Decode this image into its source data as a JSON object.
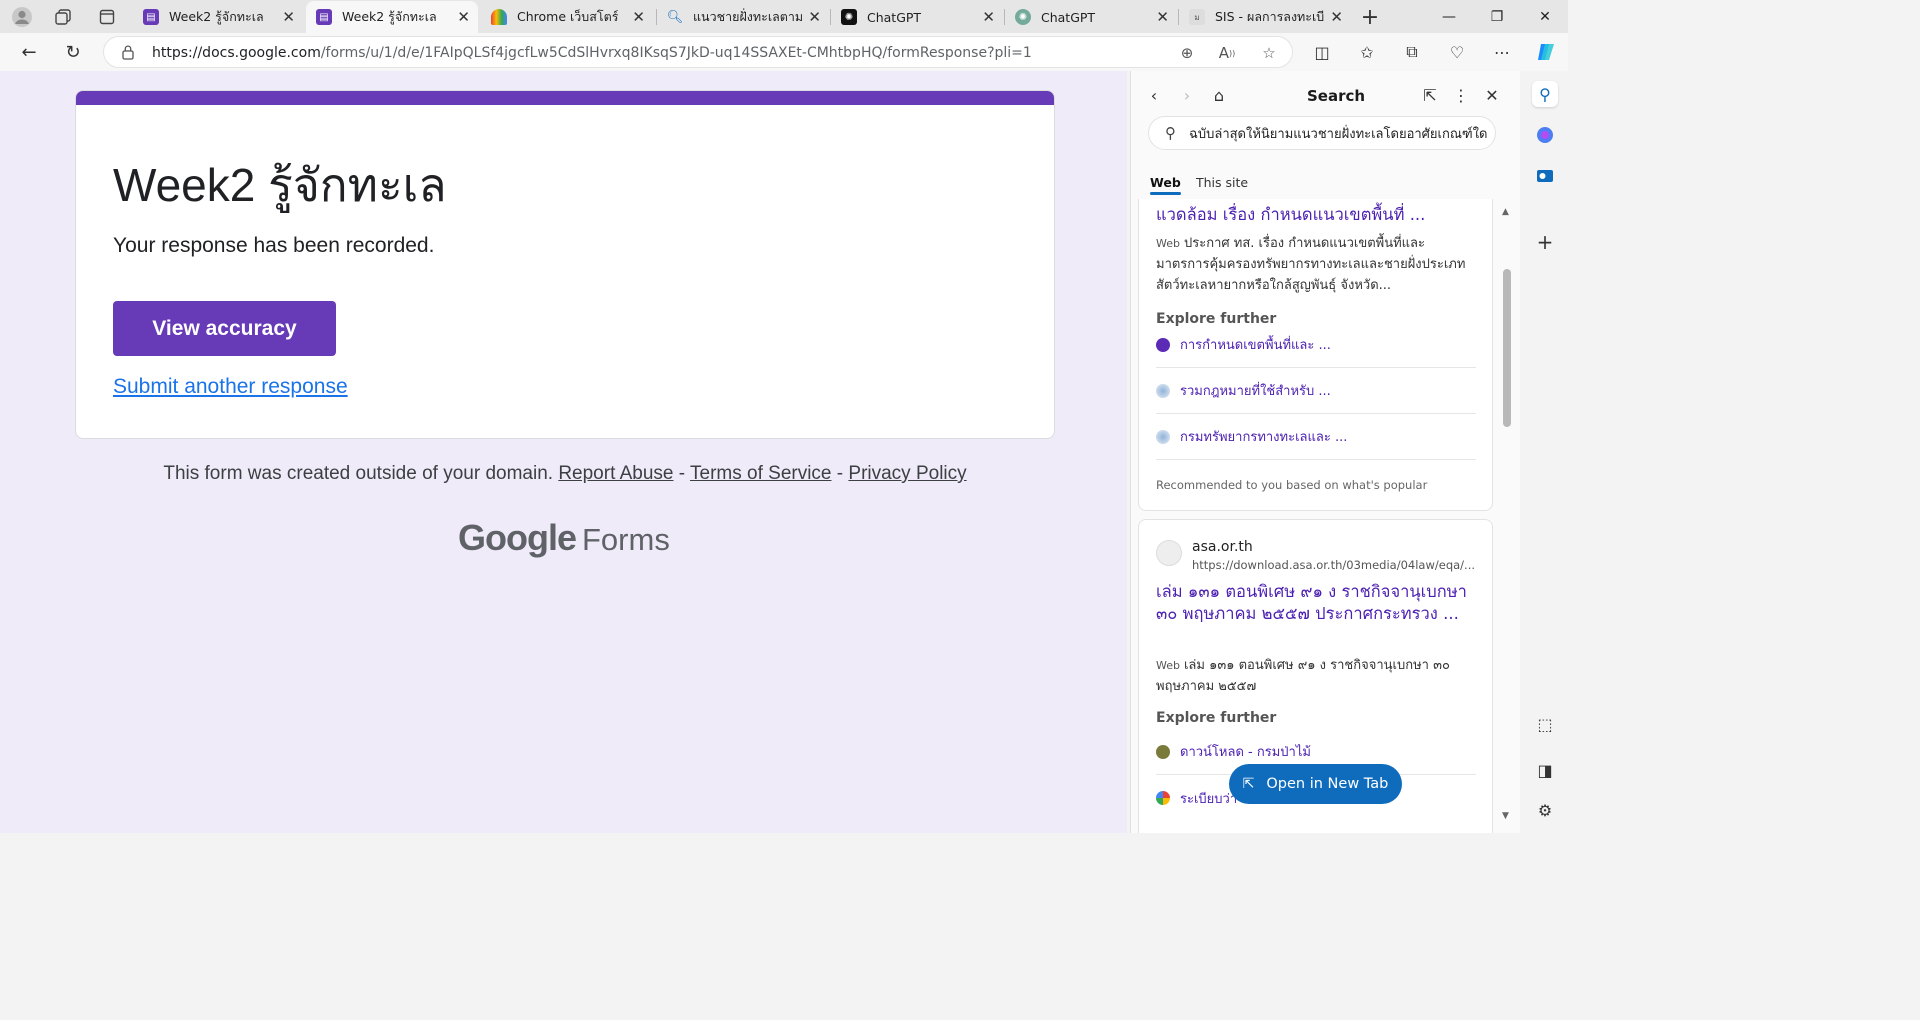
{
  "tabs": [
    {
      "label": "Week2 รู้จักทะเล",
      "active": false,
      "favicon": "google-forms-icon"
    },
    {
      "label": "Week2 รู้จักทะเล",
      "active": true,
      "favicon": "google-forms-icon"
    },
    {
      "label": "Chrome เว็บสโตร์",
      "active": false,
      "favicon": "chrome-webstore-icon"
    },
    {
      "label": "แนวชายฝั่งทะเลตามประ",
      "active": false,
      "favicon": "search-icon"
    },
    {
      "label": "ChatGPT",
      "active": false,
      "favicon": "openai-icon"
    },
    {
      "label": "ChatGPT",
      "active": false,
      "favicon": "openai-icon"
    },
    {
      "label": "SIS - ผลการลงทะเบียน",
      "active": false,
      "favicon": "sis-icon"
    }
  ],
  "address": {
    "host": "https://docs.google.com",
    "path": "/forms/u/1/d/e/1FAIpQLSf4jgcfLw5CdSlHvrxq8IKsqS7JkD-uq14SSAXEt-CMhtbpHQ/formResponse?pli=1"
  },
  "form": {
    "title": "Week2 รู้จักทะเล",
    "message": "Your response has been recorded.",
    "view_accuracy": "View accuracy",
    "submit_another": "Submit another response",
    "footer_text": "This form was created outside of your domain.",
    "report_abuse": "Report Abuse",
    "terms": "Terms of Service",
    "privacy": "Privacy Policy",
    "sep": "-",
    "logo_google": "Google",
    "logo_forms": "Forms",
    "accent_color": "#673ab7"
  },
  "panel": {
    "title": "Search",
    "query": "ฉบับล่าสุดให้นิยามแนวชายฝั่งทะเลโดยอาศัยเกณฑ์ใด",
    "tab_web": "Web",
    "tab_site": "This site",
    "result1": {
      "title": "แวดล้อม เรื่อง กำหนดแนวเขตพื้นที่ ...",
      "web_tag": "Web",
      "snippet": "ประกาศ ทส. เรื่อง กำหนดแนวเขตพื้นที่และมาตรการคุ้มครองทรัพยากรทางทะเลและชายฝั่งประเภทสัตว์ทะเลหายากหรือใกล้สูญพันธุ์ จังหวัด...",
      "explore_label": "Explore further",
      "explore": [
        "การกำหนดเขตพื้นที่และ ...",
        "รวมกฎหมายที่ใช้สำหรับ ...",
        "กรมทรัพยากรทางทะเลและ ..."
      ],
      "rec_note": "Recommended to you based on what's popular"
    },
    "result2": {
      "site_name": "asa.or.th",
      "site_url": "https://download.asa.or.th/03media/04law/eqa/...",
      "title": "เล่ม ๑๓๑ ตอนพิเศษ ๙๑ ง ราชกิจจานุเบกษา ๓๐ พฤษภาคม ๒๕๕๗ ประกาศกระทรวง ...",
      "web_tag": "Web",
      "snippet": "เล่ม ๑๓๑ ตอนพิเศษ ๙๑ ง ราชกิจจานุเบกษา ๓๐ พฤษภาคม ๒๕๕๗",
      "explore_label": "Explore further",
      "explore": [
        "ดาวน์โหลด - กรมป่าไม้",
        "ระเบียบว่า"
      ]
    },
    "open_new_tab": "Open in New Tab",
    "accent_color": "#0f6cbd"
  }
}
